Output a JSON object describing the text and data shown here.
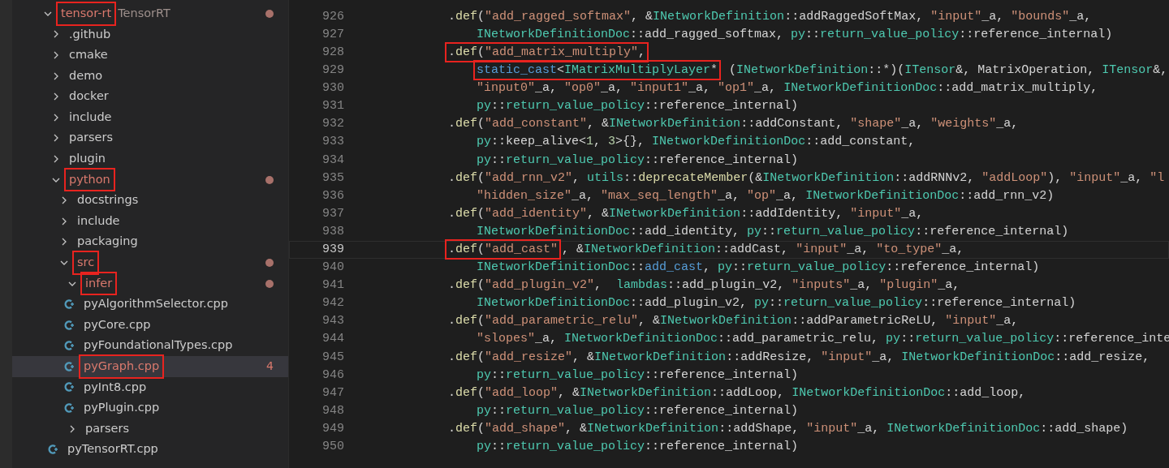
{
  "explorer": {
    "tree": [
      {
        "label": "tensor-rt",
        "description": "TensorRT",
        "kind": "folder",
        "expanded": true,
        "modified": true,
        "dot": true,
        "annotated": true,
        "selected": false,
        "children": [
          {
            "label": ".github",
            "kind": "folder",
            "expanded": false,
            "modified": false,
            "selected": false
          },
          {
            "label": "cmake",
            "kind": "folder",
            "expanded": false,
            "modified": false,
            "selected": false
          },
          {
            "label": "demo",
            "kind": "folder",
            "expanded": false,
            "modified": false,
            "selected": false
          },
          {
            "label": "docker",
            "kind": "folder",
            "expanded": false,
            "modified": false,
            "selected": false
          },
          {
            "label": "include",
            "kind": "folder",
            "expanded": false,
            "modified": false,
            "selected": false
          },
          {
            "label": "parsers",
            "kind": "folder",
            "expanded": false,
            "modified": false,
            "selected": false
          },
          {
            "label": "plugin",
            "kind": "folder",
            "expanded": false,
            "modified": false,
            "selected": false
          },
          {
            "label": "python",
            "kind": "folder",
            "expanded": true,
            "modified": true,
            "dot": true,
            "annotated": true,
            "selected": false,
            "children": [
              {
                "label": "docstrings",
                "kind": "folder",
                "expanded": false,
                "modified": false,
                "selected": false
              },
              {
                "label": "include",
                "kind": "folder",
                "expanded": false,
                "modified": false,
                "selected": false
              },
              {
                "label": "packaging",
                "kind": "folder",
                "expanded": false,
                "modified": false,
                "selected": false
              },
              {
                "label": "src",
                "kind": "folder",
                "expanded": true,
                "modified": true,
                "dot": true,
                "annotated": true,
                "selected": false,
                "children": [
                  {
                    "label": "infer",
                    "kind": "folder",
                    "expanded": true,
                    "modified": true,
                    "dot": true,
                    "annotated": true,
                    "selected": false,
                    "children": [
                      {
                        "label": "pyAlgorithmSelector.cpp",
                        "kind": "file",
                        "modified": false,
                        "selected": false
                      },
                      {
                        "label": "pyCore.cpp",
                        "kind": "file",
                        "modified": false,
                        "selected": false
                      },
                      {
                        "label": "pyFoundationalTypes.cpp",
                        "kind": "file",
                        "modified": false,
                        "selected": false
                      },
                      {
                        "label": "pyGraph.cpp",
                        "kind": "file",
                        "modified": true,
                        "badge": "4",
                        "annotated": true,
                        "selected": true
                      },
                      {
                        "label": "pyInt8.cpp",
                        "kind": "file",
                        "modified": false,
                        "selected": false
                      },
                      {
                        "label": "pyPlugin.cpp",
                        "kind": "file",
                        "modified": false,
                        "selected": false
                      }
                    ]
                  },
                  {
                    "label": "parsers",
                    "kind": "folder",
                    "expanded": false,
                    "modified": false,
                    "selected": false
                  }
                ]
              },
              {
                "label": "pyTensorRT.cpp",
                "kind": "file",
                "modified": false,
                "selected": false
              }
            ]
          }
        ]
      }
    ]
  },
  "editor": {
    "lines": [
      {
        "number": "926",
        "kind": "def",
        "text": ".def(\"add_ragged_softmax\", &INetworkDefinition::addRaggedSoftMax, \"input\"_a, \"bounds\"_a,",
        "current": false
      },
      {
        "number": "927",
        "kind": "cont",
        "text": "INetworkDefinitionDoc::add_ragged_softmax, py::return_value_policy::reference_internal)",
        "current": false
      },
      {
        "number": "928",
        "kind": "def",
        "boxed": ".def(\"add_matrix_multiply\",",
        "current": false
      },
      {
        "number": "929",
        "kind": "cont",
        "boxed": "static_cast<IMatrixMultiplyLayer*",
        "text": " (INetworkDefinition::*)(ITensor&, MatrixOperation, ITensor&,",
        "current": false
      },
      {
        "number": "930",
        "kind": "cont",
        "text": "\"input0\"_a, \"op0\"_a, \"input1\"_a, \"op1\"_a, INetworkDefinitionDoc::add_matrix_multiply,",
        "current": false
      },
      {
        "number": "931",
        "kind": "cont",
        "text": "py::return_value_policy::reference_internal)",
        "current": false
      },
      {
        "number": "932",
        "kind": "def",
        "text": ".def(\"add_constant\", &INetworkDefinition::addConstant, \"shape\"_a, \"weights\"_a,",
        "current": false
      },
      {
        "number": "933",
        "kind": "cont",
        "text": "py::keep_alive<1, 3>{}, INetworkDefinitionDoc::add_constant,",
        "current": false
      },
      {
        "number": "934",
        "kind": "cont",
        "text": "py::return_value_policy::reference_internal)",
        "current": false
      },
      {
        "number": "935",
        "kind": "def",
        "text": ".def(\"add_rnn_v2\", utils::deprecateMember(&INetworkDefinition::addRNNv2, \"addLoop\"), \"input\"_a, \"l",
        "current": false
      },
      {
        "number": "936",
        "kind": "cont",
        "text": "\"hidden_size\"_a, \"max_seq_length\"_a, \"op\"_a, INetworkDefinitionDoc::add_rnn_v2)",
        "current": false
      },
      {
        "number": "937",
        "kind": "def",
        "text": ".def(\"add_identity\", &INetworkDefinition::addIdentity, \"input\"_a,",
        "current": false
      },
      {
        "number": "938",
        "kind": "cont",
        "text": "INetworkDefinitionDoc::add_identity, py::return_value_policy::reference_internal)",
        "current": false
      },
      {
        "number": "939",
        "kind": "def",
        "boxed": ".def(\"add_cast\"",
        "text": ", &INetworkDefinition::addCast, \"input\"_a, \"to_type\"_a,",
        "current": true
      },
      {
        "number": "940",
        "kind": "cont",
        "text": "INetworkDefinitionDoc::add_cast, py::return_value_policy::reference_internal)",
        "current": false
      },
      {
        "number": "941",
        "kind": "def",
        "text": ".def(\"add_plugin_v2\",  lambdas::add_plugin_v2, \"inputs\"_a, \"plugin\"_a,",
        "current": false
      },
      {
        "number": "942",
        "kind": "cont",
        "text": "INetworkDefinitionDoc::add_plugin_v2, py::return_value_policy::reference_internal)",
        "current": false
      },
      {
        "number": "943",
        "kind": "def",
        "text": ".def(\"add_parametric_relu\", &INetworkDefinition::addParametricReLU, \"input\"_a,",
        "current": false
      },
      {
        "number": "944",
        "kind": "cont",
        "text": "\"slopes\"_a, INetworkDefinitionDoc::add_parametric_relu, py::return_value_policy::reference_inte",
        "current": false
      },
      {
        "number": "945",
        "kind": "def",
        "text": ".def(\"add_resize\", &INetworkDefinition::addResize, \"input\"_a, INetworkDefinitionDoc::add_resize,",
        "current": false
      },
      {
        "number": "946",
        "kind": "cont",
        "text": "py::return_value_policy::reference_internal)",
        "current": false
      },
      {
        "number": "947",
        "kind": "def",
        "text": ".def(\"add_loop\", &INetworkDefinition::addLoop, INetworkDefinitionDoc::add_loop,",
        "current": false
      },
      {
        "number": "948",
        "kind": "cont",
        "text": "py::return_value_policy::reference_internal)",
        "current": false
      },
      {
        "number": "949",
        "kind": "def",
        "text": ".def(\"add_shape\", &INetworkDefinition::addShape, \"input\"_a, INetworkDefinitionDoc::add_shape)",
        "current": false
      },
      {
        "number": "950",
        "kind": "cont",
        "text": "py::return_value_policy::reference_internal)",
        "current": false
      }
    ]
  }
}
